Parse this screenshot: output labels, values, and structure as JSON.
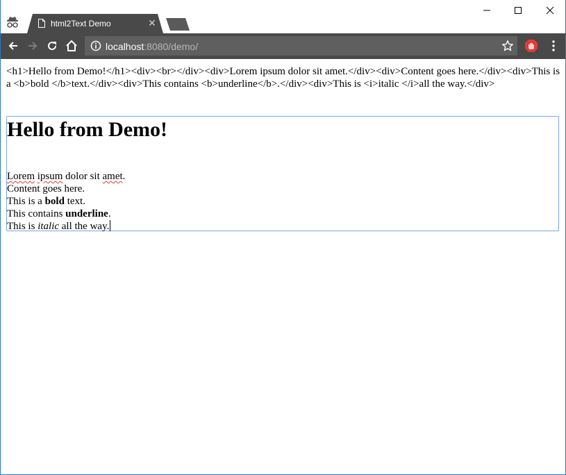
{
  "browser": {
    "tab_title": "html2Text Demo",
    "tab_close_glyph": "✕",
    "url_host": "localhost",
    "url_rest": ":8080/demo/",
    "icons": [
      "incognito-icon",
      "document-icon",
      "back-icon",
      "forward-icon",
      "reload-icon",
      "home-icon",
      "info-icon",
      "star-icon",
      "stop-extension-icon",
      "more-menu-icon",
      "minimize-icon",
      "maximize-icon",
      "close-icon"
    ]
  },
  "page": {
    "raw_html": "<h1>Hello from Demo!</h1><div><br></div><div>Lorem ipsum dolor sit amet.</div><div>Content goes here.</div><div>This is a <b>bold </b>text.</div><div>This contains <b>underline</b>.</div><div>This is <i>italic </i>all the way.</div>",
    "editor": {
      "heading": "Hello from Demo!",
      "line1_w1": "Lorem",
      "line1_w2": "ipsum",
      "line1_mid": "dolor sit",
      "line1_w3": "amet",
      "line1_end": ".",
      "line2": "Content goes here.",
      "line3_pre": "This is a ",
      "line3_bold": "bold",
      "line3_post": " text.",
      "line4_pre": "This contains ",
      "line4_bold": "underline",
      "line4_post": ".",
      "line5_pre": "This is ",
      "line5_italic": "italic",
      "line5_post": " all the way."
    }
  },
  "colors": {
    "tab_bg": "#494949",
    "omnibox_bg": "#5f5f5f",
    "editor_border": "#7aa6e6",
    "extension_red": "#e53935"
  }
}
